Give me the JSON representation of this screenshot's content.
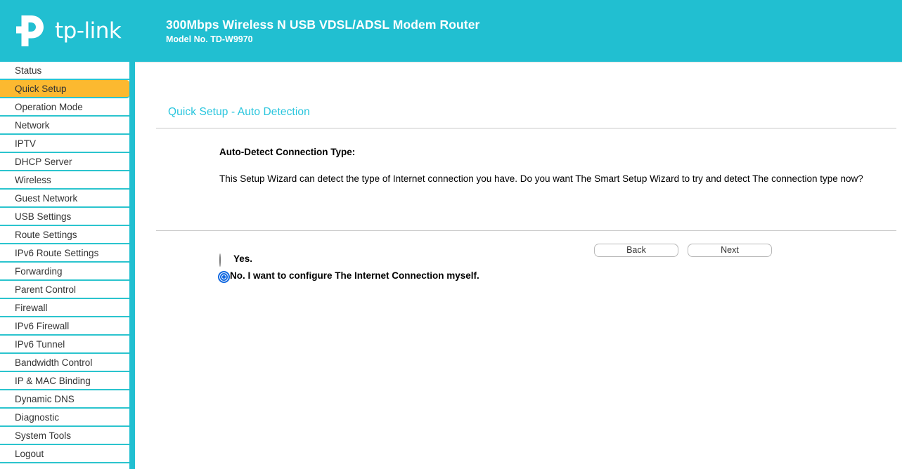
{
  "header": {
    "brand": "tp-link",
    "logo_icon": "tp-link-logo-icon",
    "product_title": "300Mbps Wireless N USB VDSL/ADSL Modem Router",
    "product_model": "Model No. TD-W9970",
    "background_color": "#21BFD1"
  },
  "sidebar": {
    "selected_index": 1,
    "selected_color": "#FCB930",
    "separator_color": "#2BC4CE",
    "items": [
      {
        "label": "Status"
      },
      {
        "label": "Quick Setup"
      },
      {
        "label": "Operation Mode"
      },
      {
        "label": "Network"
      },
      {
        "label": "IPTV"
      },
      {
        "label": "DHCP Server"
      },
      {
        "label": "Wireless"
      },
      {
        "label": "Guest Network"
      },
      {
        "label": "USB Settings"
      },
      {
        "label": "Route Settings"
      },
      {
        "label": "IPv6 Route Settings"
      },
      {
        "label": "Forwarding"
      },
      {
        "label": "Parent Control"
      },
      {
        "label": "Firewall"
      },
      {
        "label": "IPv6 Firewall"
      },
      {
        "label": "IPv6 Tunnel"
      },
      {
        "label": "Bandwidth Control"
      },
      {
        "label": "IP & MAC Binding"
      },
      {
        "label": "Dynamic DNS"
      },
      {
        "label": "Diagnostic"
      },
      {
        "label": "System Tools"
      },
      {
        "label": "Logout"
      }
    ]
  },
  "main": {
    "page_heading": "Quick Setup - Auto Detection",
    "page_heading_color": "#29C5DD",
    "section_label": "Auto-Detect Connection Type:",
    "intro_text": "This Setup Wizard can detect the type of Internet connection you have. Do you want The Smart Setup Wizard to try and detect The connection type now?",
    "radio_group": {
      "name": "auto-detect-connection",
      "selected_value": "no",
      "accent_color": "#1168E0",
      "options": [
        {
          "value": "yes",
          "label": "Yes.",
          "checked": false
        },
        {
          "value": "no",
          "label": "No. I want to configure The Internet Connection myself.",
          "checked": true
        }
      ]
    },
    "buttons": {
      "back_label": "Back",
      "next_label": "Next"
    }
  }
}
